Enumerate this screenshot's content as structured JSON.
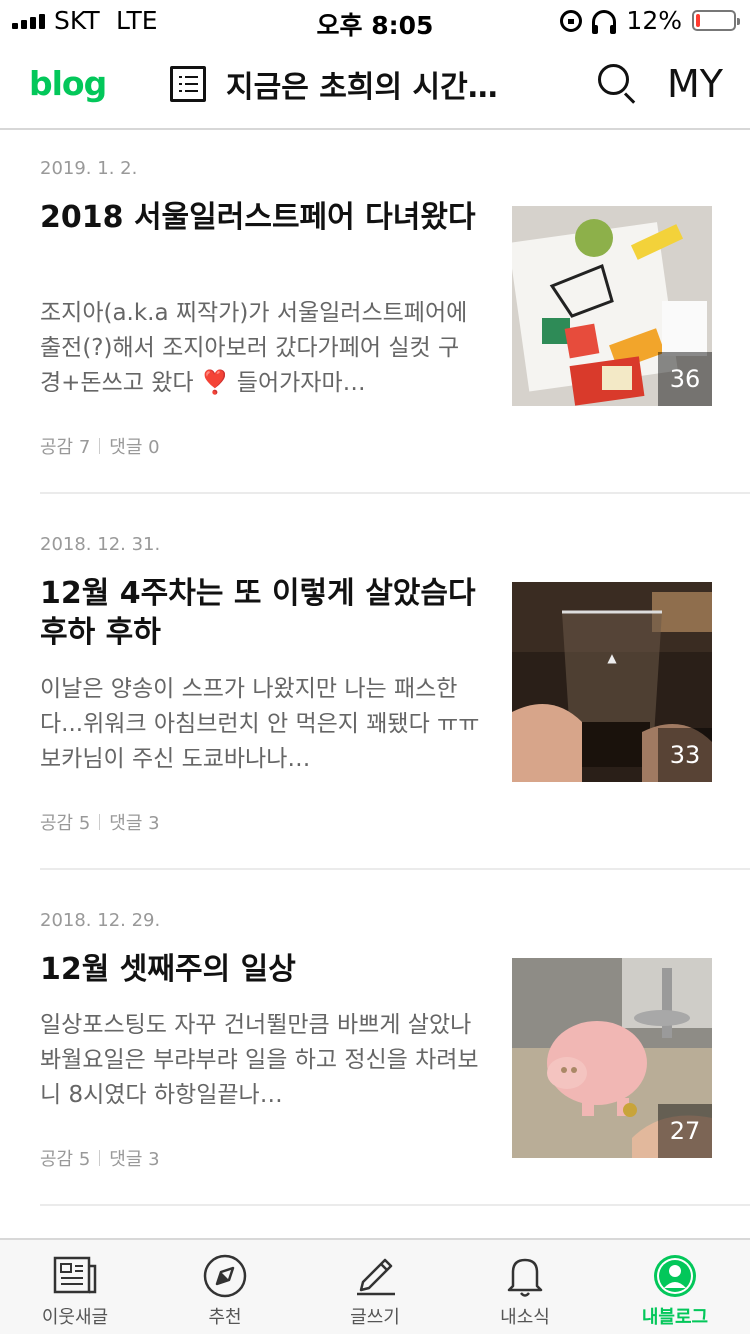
{
  "status_bar": {
    "carrier": "SKT",
    "network": "LTE",
    "time": "오후 8:05",
    "battery_percent": "12%",
    "battery_level": 0.12
  },
  "header": {
    "logo": "blog",
    "title": "지금은 초희의 시간…",
    "my_label": "MY",
    "icons": [
      "list-icon",
      "search-icon"
    ]
  },
  "posts": [
    {
      "date": "2019. 1. 2.",
      "title": "2018 서울일러스트페어 다녀왔다",
      "excerpt": "조지아(a.k.a 찌작가)가 서울일러스트페어에출전(?)해서 조지아보러 갔다가페어 실컷 구경+돈쓰고 왔다 ❣️ 들어가자마…",
      "likes": "공감 7",
      "comments": "댓글 0",
      "photo_count": "36"
    },
    {
      "date": "2018. 12. 31.",
      "title": "12월 4주차는 또 이렇게 살았슴다 후하 후하",
      "excerpt": "이날은 양송이 스프가 나왔지만 나는 패스한다...위워크 아침브런치 안 먹은지 꽤됐다 ㅠㅠ보카님이 주신 도쿄바나나…",
      "likes": "공감 5",
      "comments": "댓글 3",
      "photo_count": "33"
    },
    {
      "date": "2018. 12. 29.",
      "title": "12월 셋째주의 일상",
      "excerpt": "일상포스팅도 자꾸 건너뛸만큼 바쁘게 살았나봐월요일은 부랴부랴 일을 하고 정신을 차려보니 8시였다 하항일끝나…",
      "likes": "공감 5",
      "comments": "댓글 3",
      "photo_count": "27"
    }
  ],
  "tabs": [
    {
      "label": "이웃새글",
      "icon": "newspaper-icon",
      "active": false
    },
    {
      "label": "추천",
      "icon": "compass-icon",
      "active": false
    },
    {
      "label": "글쓰기",
      "icon": "pencil-icon",
      "active": false
    },
    {
      "label": "내소식",
      "icon": "bell-icon",
      "active": false
    },
    {
      "label": "내블로그",
      "icon": "profile-icon",
      "active": true
    }
  ],
  "colors": {
    "brand": "#03c75a",
    "battery_low": "#ff3b30"
  }
}
